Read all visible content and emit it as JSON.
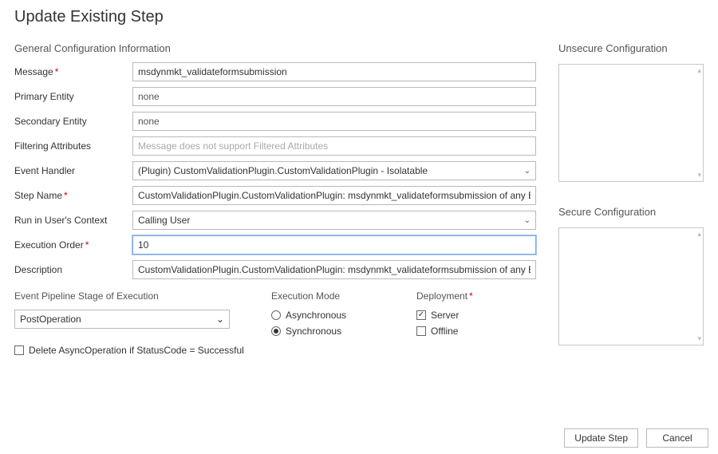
{
  "title": "Update Existing Step",
  "section_general": "General Configuration Information",
  "labels": {
    "message": "Message",
    "primary_entity": "Primary Entity",
    "secondary_entity": "Secondary Entity",
    "filtering_attributes": "Filtering Attributes",
    "event_handler": "Event Handler",
    "step_name": "Step Name",
    "run_in_user": "Run in User's Context",
    "execution_order": "Execution Order",
    "description": "Description"
  },
  "required_marker": "*",
  "values": {
    "message": "msdynmkt_validateformsubmission",
    "primary_entity": "none",
    "secondary_entity": "none",
    "filtering_attributes_placeholder": "Message does not support Filtered Attributes",
    "event_handler": "(Plugin) CustomValidationPlugin.CustomValidationPlugin - Isolatable",
    "step_name": "CustomValidationPlugin.CustomValidationPlugin: msdynmkt_validateformsubmission of any Ent",
    "run_in_user": "Calling User",
    "execution_order": "10",
    "description": "CustomValidationPlugin.CustomValidationPlugin: msdynmkt_validateformsubmission of any Ent"
  },
  "pipeline": {
    "heading": "Event Pipeline Stage of Execution",
    "stage_value": "PostOperation"
  },
  "exec_mode": {
    "heading": "Execution Mode",
    "asynchronous": "Asynchronous",
    "synchronous": "Synchronous",
    "selected": "synchronous"
  },
  "deployment": {
    "heading": "Deployment",
    "server": "Server",
    "offline": "Offline",
    "server_checked": true,
    "offline_checked": false
  },
  "delete_async_label": "Delete AsyncOperation if StatusCode = Successful",
  "delete_async_checked": false,
  "unsecure_heading": "Unsecure  Configuration",
  "secure_heading": "Secure  Configuration",
  "buttons": {
    "update": "Update Step",
    "cancel": "Cancel"
  }
}
